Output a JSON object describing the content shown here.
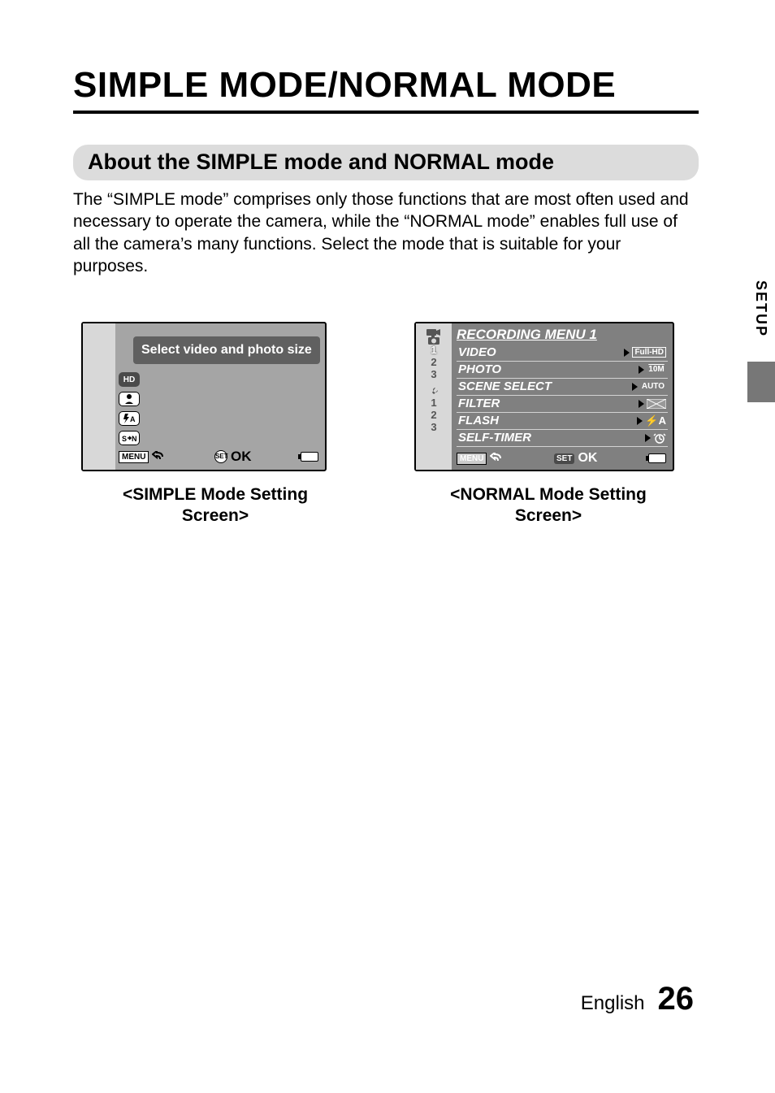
{
  "title": "SIMPLE MODE/NORMAL MODE",
  "section_heading": "About the SIMPLE mode and NORMAL mode",
  "body": "The “SIMPLE mode” comprises only those functions that are most often used and necessary to operate the camera, while the “NORMAL mode” enables full use of all the camera’s many functions. Select the mode that is suitable for your purposes.",
  "side_tab": "SETUP",
  "footer": {
    "language": "English",
    "page": "26"
  },
  "simple": {
    "tooltip": "Select video and photo size",
    "icons": [
      "HD",
      "face",
      "flash-auto",
      "sn"
    ],
    "bottom": {
      "menu": "MENU",
      "ok": "OK"
    },
    "caption_line1": "<SIMPLE Mode Setting",
    "caption_line2": "Screen>"
  },
  "normal": {
    "header": "RECORDING MENU 1",
    "left_tabs": {
      "group1": [
        "1",
        "2",
        "3"
      ],
      "group2": [
        "1",
        "2",
        "3"
      ]
    },
    "rows": [
      {
        "name": "VIDEO",
        "value": "Full-HD"
      },
      {
        "name": "PHOTO",
        "value": "10M"
      },
      {
        "name": "SCENE SELECT",
        "value": "AUTO"
      },
      {
        "name": "FILTER",
        "value": "off"
      },
      {
        "name": "FLASH",
        "value": "⚡A"
      },
      {
        "name": "SELF-TIMER",
        "value": "timer"
      }
    ],
    "bottom": {
      "menu": "MENU",
      "set": "SET",
      "ok": "OK"
    },
    "caption_line1": "<NORMAL Mode Setting",
    "caption_line2": "Screen>"
  }
}
